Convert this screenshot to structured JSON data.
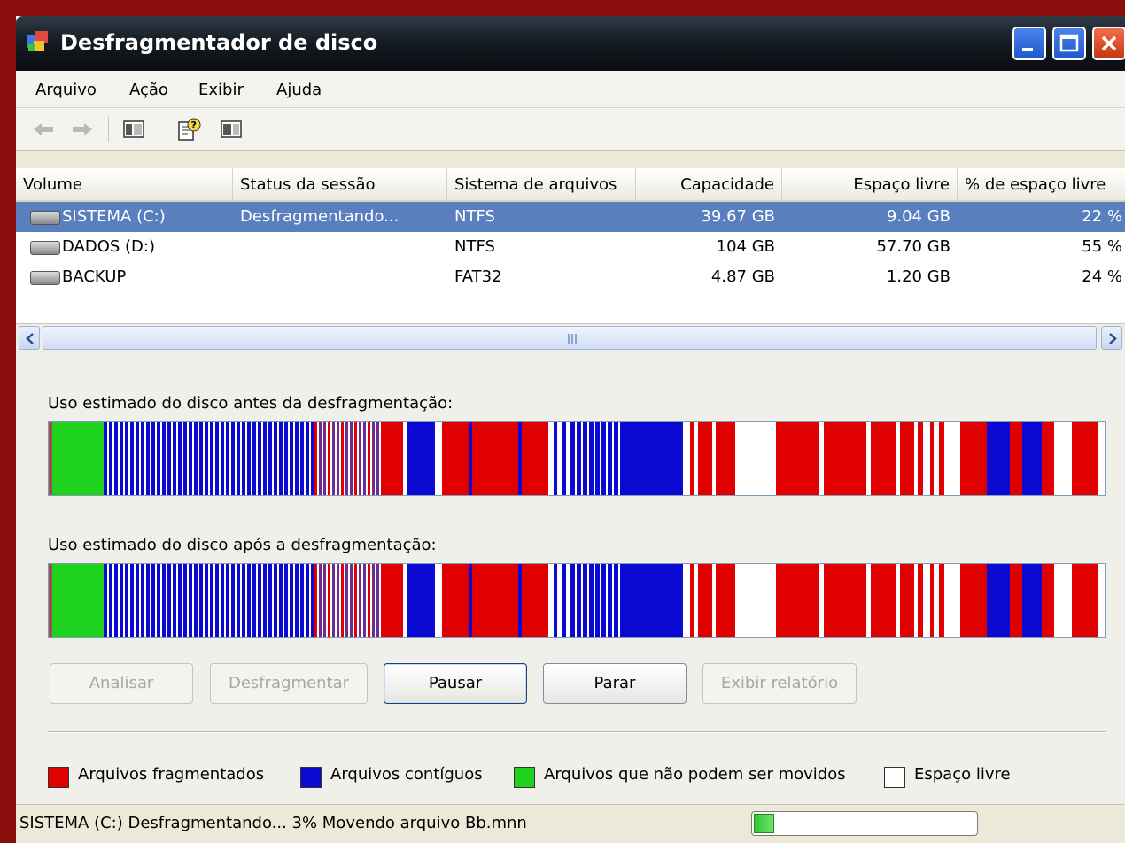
{
  "window": {
    "title": "Desfragmentador de disco",
    "controls": [
      "minimize",
      "maximize",
      "close"
    ]
  },
  "menu": [
    "Arquivo",
    "Ação",
    "Exibir",
    "Ajuda"
  ],
  "toolbar": {
    "icons": [
      "back-arrow-icon",
      "forward-arrow-icon",
      "show-hide-console-tree-icon",
      "help-icon",
      "show-hide-action-pane-icon"
    ]
  },
  "volumes": {
    "columns": [
      "Volume",
      "Status da sessão",
      "Sistema de arquivos",
      "Capacidade",
      "Espaço livre",
      "% de espaço livre"
    ],
    "rows": [
      {
        "volume": "SISTEMA (C:)",
        "status": "Desfragmentando...",
        "fs": "NTFS",
        "capacity": "39.67 GB",
        "free": "9.04 GB",
        "free_pct": "22 %",
        "selected": true
      },
      {
        "volume": "DADOS (D:)",
        "status": "",
        "fs": "NTFS",
        "capacity": "104 GB",
        "free": "57.70 GB",
        "free_pct": "55 %",
        "selected": false
      },
      {
        "volume": "BACKUP",
        "status": "",
        "fs": "FAT32",
        "capacity": "4.87 GB",
        "free": "1.20 GB",
        "free_pct": "24 %",
        "selected": false
      }
    ]
  },
  "analysis": {
    "before_label": "Uso estimado do disco antes da desfragmentação:",
    "after_label": "Uso estimado do disco após a desfragmentação:"
  },
  "buttons": {
    "analyze": "Analisar",
    "defragment": "Desfragmentar",
    "pause": "Pausar",
    "stop": "Parar",
    "view_report": "Exibir relatório"
  },
  "legend": [
    {
      "label": "Arquivos fragmentados",
      "color": "#e00000"
    },
    {
      "label": "Arquivos contíguos",
      "color": "#0a0ad2"
    },
    {
      "label": "Arquivos que não podem ser movidos",
      "color": "#1ed21e"
    },
    {
      "label": "Espaço livre",
      "color": "#ffffff"
    }
  ],
  "status": {
    "text": "SISTEMA (C:) Desfragmentando... 3%  Movendo arquivo Bb.mnn",
    "progress": 0.03
  }
}
